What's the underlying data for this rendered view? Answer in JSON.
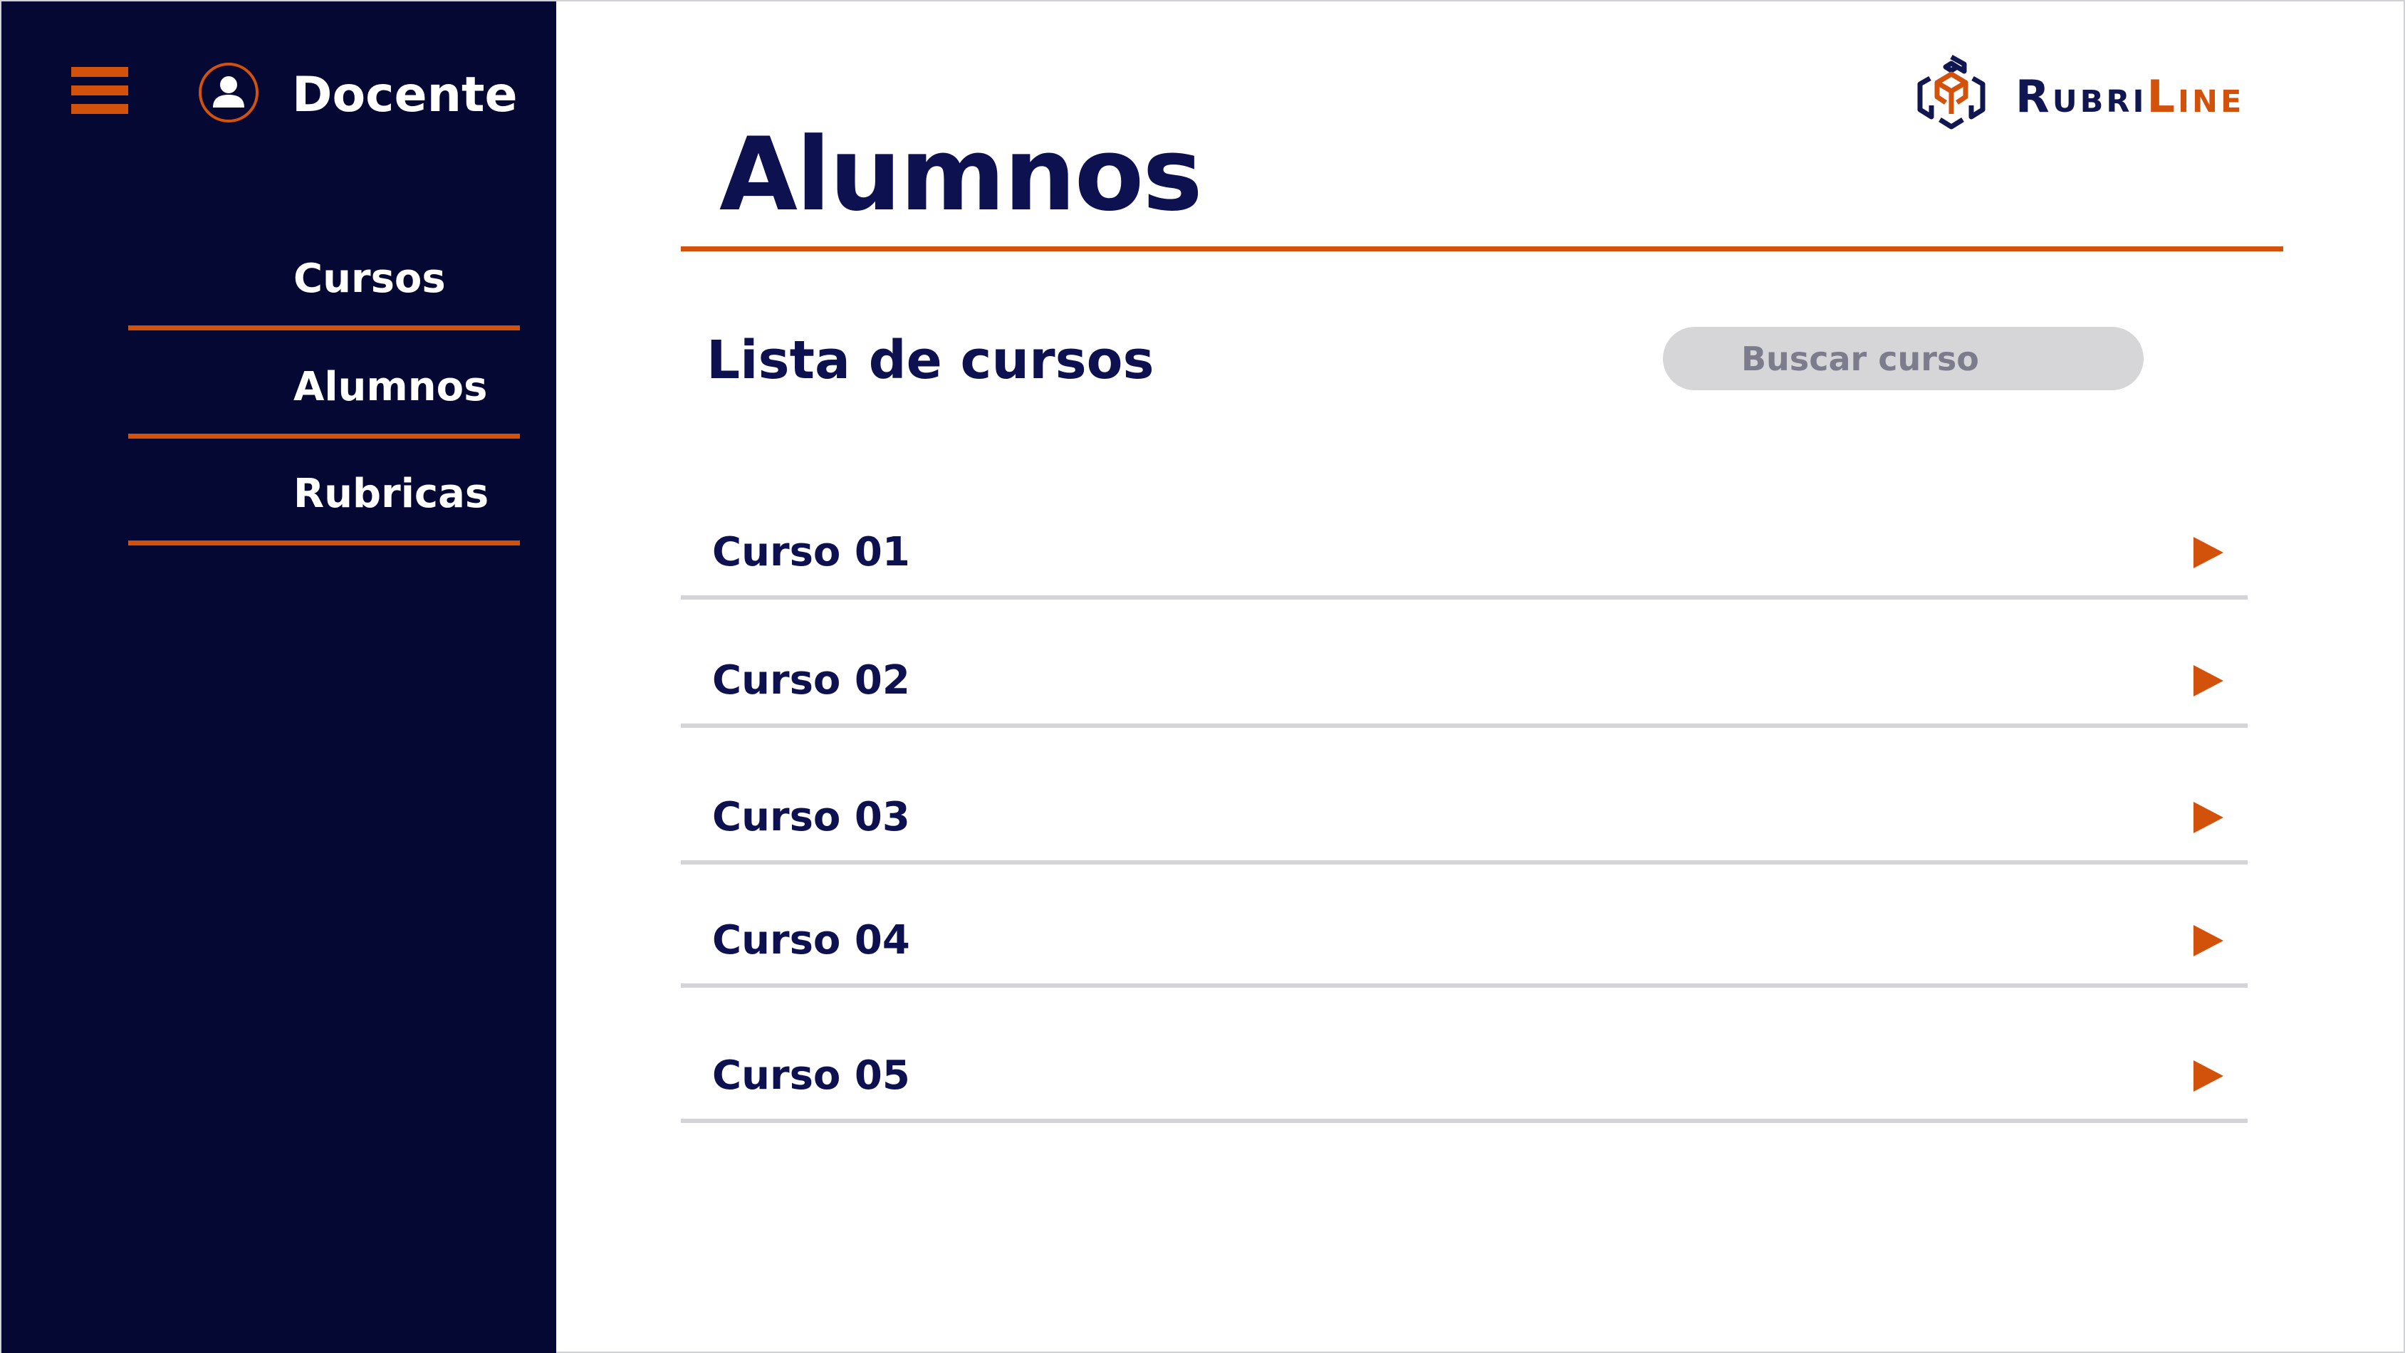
{
  "sidebar": {
    "user_name": "Docente",
    "menu_icon": "hamburger-menu-icon",
    "avatar_icon": "user-avatar-icon",
    "items": [
      {
        "label": "Cursos"
      },
      {
        "label": "Alumnos"
      },
      {
        "label": "Rubricas"
      }
    ]
  },
  "header": {
    "logo": {
      "part1": "Rubri",
      "part2": "Line",
      "icon": "rubriline-logo-icon"
    },
    "title": "Alumnos"
  },
  "main": {
    "section_title": "Lista de cursos",
    "search": {
      "placeholder": "Buscar curso",
      "value": ""
    },
    "courses": [
      {
        "name": "Curso 01",
        "icon": "play-arrow-icon"
      },
      {
        "name": "Curso 02",
        "icon": "play-arrow-icon"
      },
      {
        "name": "Curso 03",
        "icon": "play-arrow-icon"
      },
      {
        "name": "Curso 04",
        "icon": "play-arrow-icon"
      },
      {
        "name": "Curso 05",
        "icon": "play-arrow-icon"
      }
    ]
  },
  "colors": {
    "sidebar_bg": "#040832",
    "accent": "#d2520c",
    "title_text": "#0d1150",
    "search_bg": "#d6d6d9",
    "row_divider": "#d4d4d8"
  }
}
